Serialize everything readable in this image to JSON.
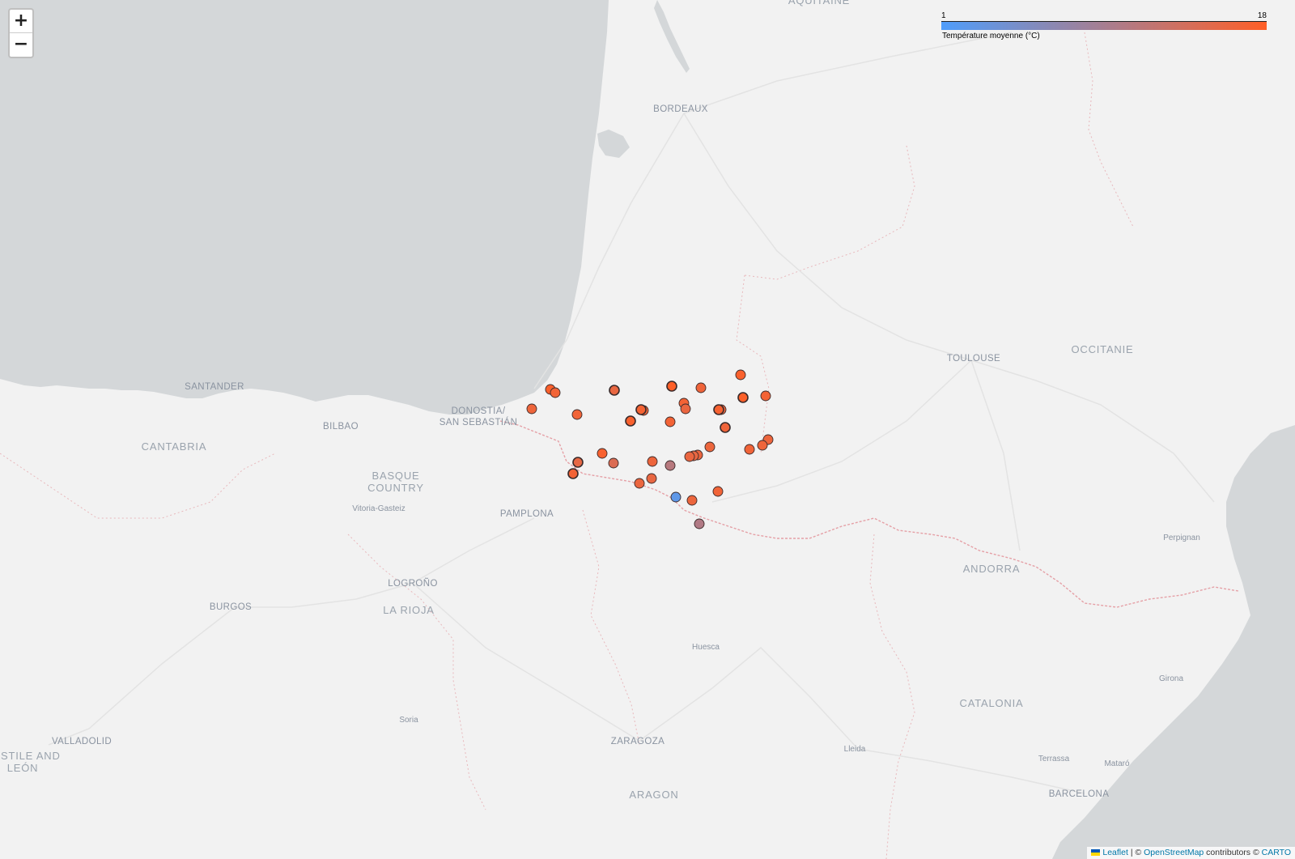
{
  "map": {
    "labels": [
      {
        "text": "AQUITAINE",
        "kind": "big"
      },
      {
        "text": "BORDEAUX",
        "kind": "normal"
      },
      {
        "text": "TOULOUSE",
        "kind": "normal"
      },
      {
        "text": "OCCITANIE",
        "kind": "big"
      },
      {
        "text": "SANTANDER",
        "kind": "normal"
      },
      {
        "text": "BILBAO",
        "kind": "normal"
      },
      {
        "text": "DONOSTIA/\nSAN SEBASTIÁN",
        "kind": "normal"
      },
      {
        "text": "CANTABRIA",
        "kind": "big"
      },
      {
        "text": "BASQUE\nCOUNTRY",
        "kind": "big"
      },
      {
        "text": "Vitoria-Gasteiz",
        "kind": "small"
      },
      {
        "text": "PAMPLONA",
        "kind": "normal"
      },
      {
        "text": "LOGROÑO",
        "kind": "normal"
      },
      {
        "text": "LA RIOJA",
        "kind": "big"
      },
      {
        "text": "BURGOS",
        "kind": "normal"
      },
      {
        "text": "Soria",
        "kind": "small"
      },
      {
        "text": "VALLADOLID",
        "kind": "normal"
      },
      {
        "text": "CASTILE AND\nLEÓN",
        "kind": "big"
      },
      {
        "text": "ZARAGOZA",
        "kind": "normal"
      },
      {
        "text": "ARAGON",
        "kind": "big"
      },
      {
        "text": "Huesca",
        "kind": "small"
      },
      {
        "text": "ANDORRA",
        "kind": "big"
      },
      {
        "text": "CATALONIA",
        "kind": "big"
      },
      {
        "text": "Perpignan",
        "kind": "small"
      },
      {
        "text": "Girona",
        "kind": "small"
      },
      {
        "text": "Lleida",
        "kind": "small"
      },
      {
        "text": "Terrassa",
        "kind": "small"
      },
      {
        "text": "Mataró",
        "kind": "small"
      },
      {
        "text": "BARCELONA",
        "kind": "normal"
      }
    ]
  },
  "zoom": {
    "in_label": "+",
    "out_label": "−"
  },
  "legend": {
    "min": "1",
    "max": "18",
    "caption": "Température moyenne (°C)",
    "color_low": "#4f9dfb",
    "color_high": "#ff5f27"
  },
  "stations": [
    {
      "temp": 17.5,
      "outlined": false
    },
    {
      "temp": 17.8,
      "outlined": true
    },
    {
      "temp": 16.8,
      "outlined": false
    },
    {
      "temp": 18.0,
      "outlined": true
    },
    {
      "temp": 16.5,
      "outlined": false
    },
    {
      "temp": 15.9,
      "outlined": true
    },
    {
      "temp": 17.6,
      "outlined": false
    },
    {
      "temp": 16.7,
      "outlined": false
    },
    {
      "temp": 16.4,
      "outlined": false
    },
    {
      "temp": 16.6,
      "outlined": false
    },
    {
      "temp": 16.2,
      "outlined": false
    },
    {
      "temp": 17.0,
      "outlined": true
    },
    {
      "temp": 16.9,
      "outlined": false
    },
    {
      "temp": 16.0,
      "outlined": false
    },
    {
      "temp": 15.8,
      "outlined": false
    },
    {
      "temp": 17.2,
      "outlined": true
    },
    {
      "temp": 17.4,
      "outlined": true
    },
    {
      "temp": 16.8,
      "outlined": false
    },
    {
      "temp": 16.5,
      "outlined": true
    },
    {
      "temp": 16.3,
      "outlined": false
    },
    {
      "temp": 16.4,
      "outlined": false
    },
    {
      "temp": 16.6,
      "outlined": false
    },
    {
      "temp": 16.2,
      "outlined": false
    },
    {
      "temp": 16.1,
      "outlined": false
    },
    {
      "temp": 15.9,
      "outlined": false
    },
    {
      "temp": 16.0,
      "outlined": false
    },
    {
      "temp": 17.3,
      "outlined": false
    },
    {
      "temp": 16.8,
      "outlined": true
    },
    {
      "temp": 15.6,
      "outlined": true
    },
    {
      "temp": 14.5,
      "outlined": false
    },
    {
      "temp": 16.3,
      "outlined": false
    },
    {
      "temp": 11.0,
      "outlined": false
    },
    {
      "temp": 15.8,
      "outlined": false
    },
    {
      "temp": 16.1,
      "outlined": false
    },
    {
      "temp": 2.5,
      "outlined": false
    },
    {
      "temp": 16.2,
      "outlined": false
    },
    {
      "temp": 10.5,
      "outlined": false
    },
    {
      "temp": 16.6,
      "outlined": false
    }
  ],
  "attribution": {
    "leaflet": "Leaflet",
    "sep1": " | © ",
    "osm": "OpenStreetMap",
    "contrib": " contributors © ",
    "carto": "CARTO"
  }
}
